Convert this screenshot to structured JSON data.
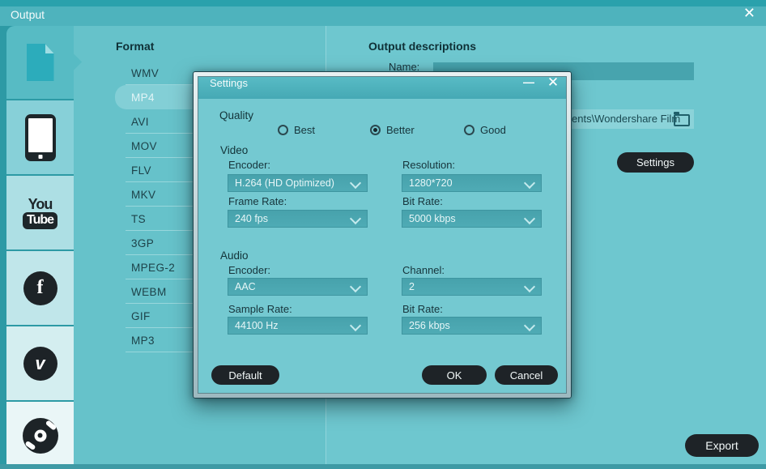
{
  "window": {
    "title": "Output",
    "close_icon": "✕"
  },
  "sidebar": {
    "items": [
      {
        "name": "document",
        "selected": true
      },
      {
        "name": "phone",
        "selected": false
      },
      {
        "name": "youtube",
        "selected": false,
        "text_top": "You",
        "text_badge": "Tube"
      },
      {
        "name": "facebook",
        "selected": false,
        "glyph": "f"
      },
      {
        "name": "vimeo",
        "selected": false,
        "glyph": "v"
      },
      {
        "name": "dvd",
        "selected": false
      }
    ]
  },
  "format": {
    "header": "Format",
    "selected": "MP4",
    "items": [
      "WMV",
      "MP4",
      "AVI",
      "MOV",
      "FLV",
      "MKV",
      "TS",
      "3GP",
      "MPEG-2",
      "WEBM",
      "GIF",
      "MP3"
    ]
  },
  "output": {
    "header": "Output descriptions",
    "name_label": "Name:",
    "path_value": "ents\\Wondershare Film",
    "settings_button": "Settings",
    "export_button": "Export"
  },
  "dialog": {
    "title": "Settings",
    "minimize_icon": "—",
    "close_icon": "✕",
    "quality": {
      "label": "Quality",
      "options": [
        {
          "label": "Best",
          "selected": false
        },
        {
          "label": "Better",
          "selected": true
        },
        {
          "label": "Good",
          "selected": false
        }
      ]
    },
    "video": {
      "title": "Video",
      "fields": [
        {
          "label": "Encoder:",
          "value": "H.264 (HD Optimized)"
        },
        {
          "label": "Resolution:",
          "value": "1280*720"
        },
        {
          "label": "Frame Rate:",
          "value": "240 fps"
        },
        {
          "label": "Bit Rate:",
          "value": "5000 kbps"
        }
      ]
    },
    "audio": {
      "title": "Audio",
      "fields": [
        {
          "label": "Encoder:",
          "value": "AAC"
        },
        {
          "label": "Channel:",
          "value": "2"
        },
        {
          "label": "Sample Rate:",
          "value": "44100 Hz"
        },
        {
          "label": "Bit Rate:",
          "value": "256 kbps"
        }
      ]
    },
    "buttons": {
      "default": "Default",
      "ok": "OK",
      "cancel": "Cancel"
    }
  },
  "colors": {
    "titlebar": "#4eb3bd",
    "base": "#68c4cc",
    "dialog_body": "#74c9d1",
    "field_dark": "#47a4ae",
    "field_light": "#8bd3d9",
    "highlight_pill": "#83cfd6",
    "dark_button": "#1e2327"
  }
}
